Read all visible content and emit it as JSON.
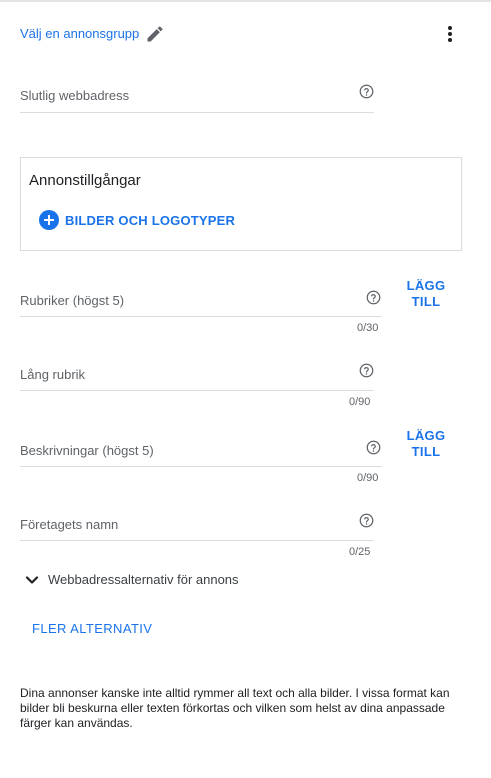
{
  "header": {
    "ad_group_label": "Välj en annonsgrupp",
    "edit_icon": "pencil-icon",
    "menu_icon": "more-vert-icon"
  },
  "final_url": {
    "label": "Slutlig webbadress",
    "help_icon": "help-circle-icon"
  },
  "assets": {
    "title": "Annonstillgångar",
    "add_label": "BILDER OCH LOGOTYPER",
    "add_icon": "plus-circle-icon"
  },
  "headlines": {
    "label": "Rubriker (högst 5)",
    "counter": "0/30",
    "add_label": "LÄGG TILL"
  },
  "long_headline": {
    "label": "Lång rubrik",
    "counter": "0/90"
  },
  "descriptions": {
    "label": "Beskrivningar (högst 5)",
    "counter": "0/90",
    "add_label": "LÄGG TILL"
  },
  "business_name": {
    "label": "Företagets namn",
    "counter": "0/25"
  },
  "url_options": {
    "label": "Webbadressalternativ för annons",
    "icon": "chevron-down-icon"
  },
  "more_options": {
    "label": "FLER ALTERNATIV"
  },
  "disclaimer": "Dina annonser kanske inte alltid rymmer all text och alla bilder. I vissa format kan bilder bli beskurna eller texten förkortas och vilken som helst av dina anpassade färger kan användas.",
  "colors": {
    "accent": "#1a73e8",
    "label": "#5f6368",
    "divider": "#dadce0"
  }
}
